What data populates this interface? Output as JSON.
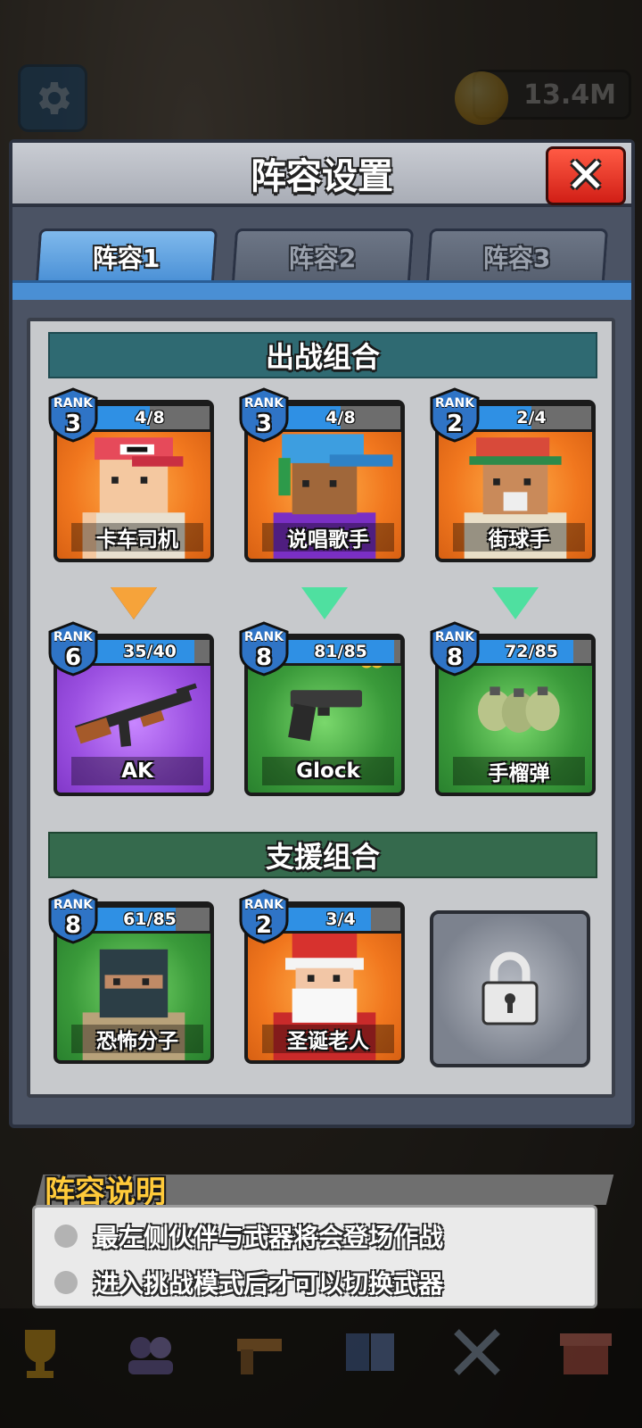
{
  "top": {
    "coins": "13.4M"
  },
  "dialog": {
    "title": "阵容设置",
    "close_label": "✕",
    "tabs": [
      {
        "label": "阵容1",
        "active": true
      },
      {
        "label": "阵容2",
        "active": false
      },
      {
        "label": "阵容3",
        "active": false
      }
    ]
  },
  "battle_section": {
    "title": "出战组合",
    "rank_label": "RANK",
    "partners": [
      {
        "rank": "3",
        "progress": "4/8",
        "progress_fraction": 0.5,
        "name": "卡车司机",
        "bg": "#f1771e"
      },
      {
        "rank": "3",
        "progress": "4/8",
        "progress_fraction": 0.5,
        "name": "说唱歌手",
        "bg": "#f1771e"
      },
      {
        "rank": "2",
        "progress": "2/4",
        "progress_fraction": 0.5,
        "name": "街球手",
        "bg": "#f1771e"
      }
    ],
    "weapons": [
      {
        "rank": "6",
        "progress": "35/40",
        "progress_fraction": 0.875,
        "name": "AK",
        "bg": "#9a4fe0",
        "infinite": false
      },
      {
        "rank": "8",
        "progress": "81/85",
        "progress_fraction": 0.95,
        "name": "Glock",
        "bg": "#3a9a3a",
        "infinite": true
      },
      {
        "rank": "8",
        "progress": "72/85",
        "progress_fraction": 0.85,
        "name": "手榴弹",
        "bg": "#3a9a3a",
        "infinite": false
      }
    ],
    "arrow_colors": [
      "#f6a33a",
      "#4fe0a0",
      "#4fe0a0"
    ]
  },
  "support_section": {
    "title": "支援组合",
    "partners": [
      {
        "rank": "8",
        "progress": "61/85",
        "progress_fraction": 0.72,
        "name": "恐怖分子",
        "bg": "#3a9a3a"
      },
      {
        "rank": "2",
        "progress": "3/4",
        "progress_fraction": 0.75,
        "name": "圣诞老人",
        "bg": "#f1771e"
      }
    ],
    "locked_slot_icon": "lock-icon"
  },
  "info": {
    "title": "阵容说明",
    "lines": [
      "最左侧伙伴与武器将会登场作战",
      "进入挑战模式后才可以切换武器"
    ]
  },
  "nav_icons": [
    "trophy-icon",
    "team-icon",
    "gun-icon",
    "book-icon",
    "battle-icon",
    "shop-icon"
  ]
}
